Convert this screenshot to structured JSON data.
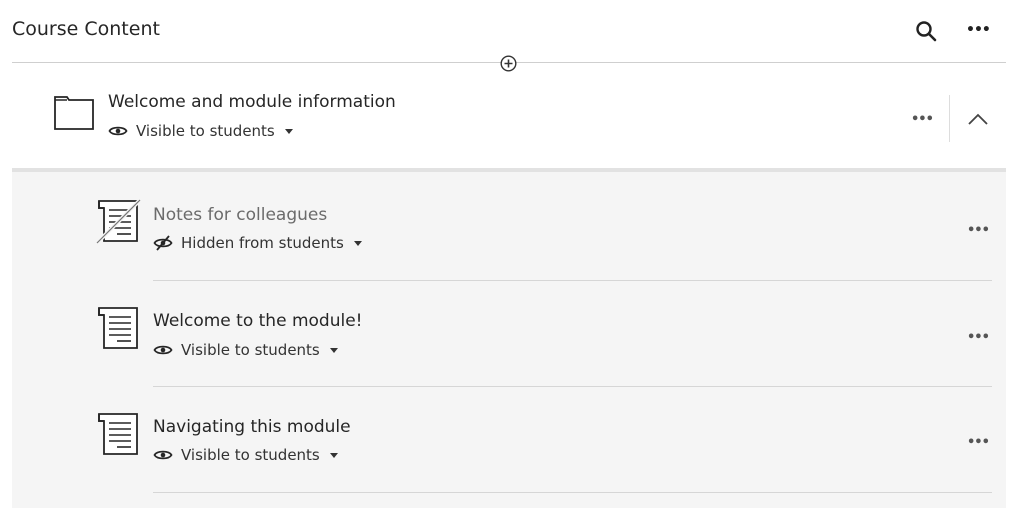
{
  "header": {
    "title": "Course Content",
    "search_icon": "search-icon",
    "more_icon": "more-icon"
  },
  "module": {
    "title": "Welcome and module information",
    "status": "Visible to students",
    "expanded": true
  },
  "items": [
    {
      "title": "Notes for colleagues",
      "status": "Hidden from students",
      "hidden": true
    },
    {
      "title": "Welcome to the module!",
      "status": "Visible to students",
      "hidden": false
    },
    {
      "title": "Navigating this module",
      "status": "Visible to students",
      "hidden": false
    }
  ],
  "more_glyph": "•••"
}
